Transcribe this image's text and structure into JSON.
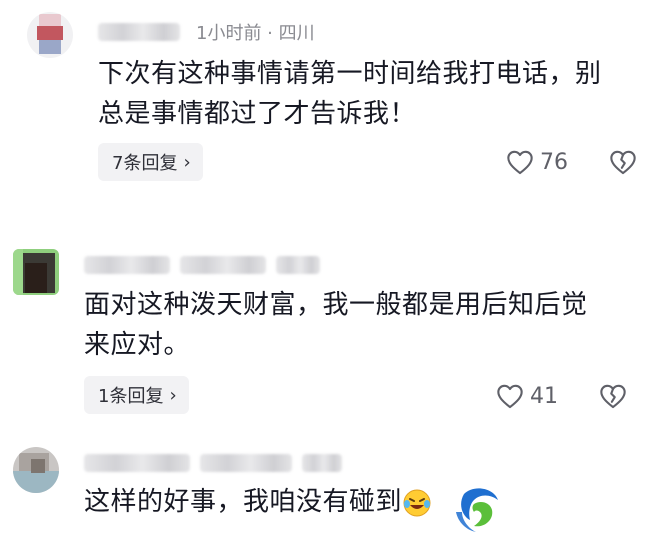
{
  "comments": [
    {
      "time_location": "1小时前 · 四川",
      "text_line1": "下次有这种事情请第一时间给我打电话，别",
      "text_line2": "总是事情都过了才告诉我！",
      "reply_label": "7条回复",
      "likes": "76"
    },
    {
      "text_line1": "面对这种泼天财富，我一般都是用后知后觉",
      "text_line2": "来应对。",
      "reply_label": "1条回复",
      "likes": "41"
    },
    {
      "text_line1": "这样的好事，我咱没有碰到"
    }
  ],
  "icons": {
    "like": "heart-outline-icon",
    "dislike": "broken-heart-icon",
    "chevron": "chevron-right-icon",
    "emoji": "laughing-crying-emoji",
    "logo": "brand-watermark-logo"
  },
  "colors": {
    "text": "#161823",
    "meta": "#8a8b91",
    "reply_bg": "#f2f2f4",
    "logo_blue": "#1f6fd0",
    "logo_green": "#5bbf3a"
  }
}
